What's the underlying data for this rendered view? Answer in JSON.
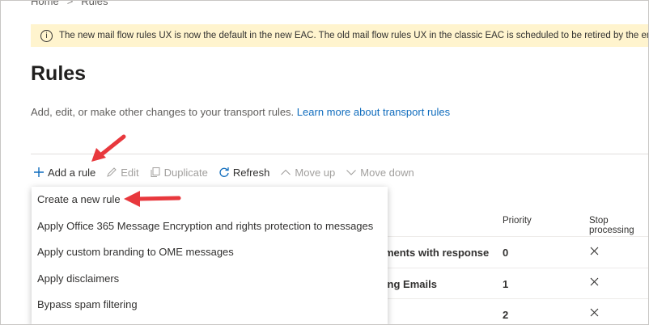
{
  "breadcrumb": {
    "home": "Home",
    "separator": ">",
    "current": "Rules"
  },
  "banner": {
    "text": "The new mail flow rules UX is now the default in the new EAC. The old mail flow rules UX in the classic EAC is scheduled to be retired by the end"
  },
  "page": {
    "title": "Rules",
    "description": "Add, edit, or make other changes to your transport rules.",
    "learn_more": "Learn more about transport rules"
  },
  "toolbar": {
    "add_rule": "Add a rule",
    "edit": "Edit",
    "duplicate": "Duplicate",
    "refresh": "Refresh",
    "move_up": "Move up",
    "move_down": "Move down"
  },
  "dropdown": {
    "items": [
      "Create a new rule",
      "Apply Office 365 Message Encryption and rights protection to messages",
      "Apply custom branding to OME messages",
      "Apply disclaimers",
      "Bypass spam filtering"
    ]
  },
  "table": {
    "columns": {
      "priority": "Priority",
      "stop_processing": "Stop processing"
    },
    "rows": [
      {
        "name_fragment": "nments with response",
        "priority": "0"
      },
      {
        "name_fragment": "ping Emails",
        "priority": "1"
      },
      {
        "name_fragment": "",
        "priority": "2"
      }
    ]
  },
  "colors": {
    "accent": "#0f6cbd",
    "banner_bg": "#fff4ce",
    "annotation_arrow": "#e8383d"
  }
}
